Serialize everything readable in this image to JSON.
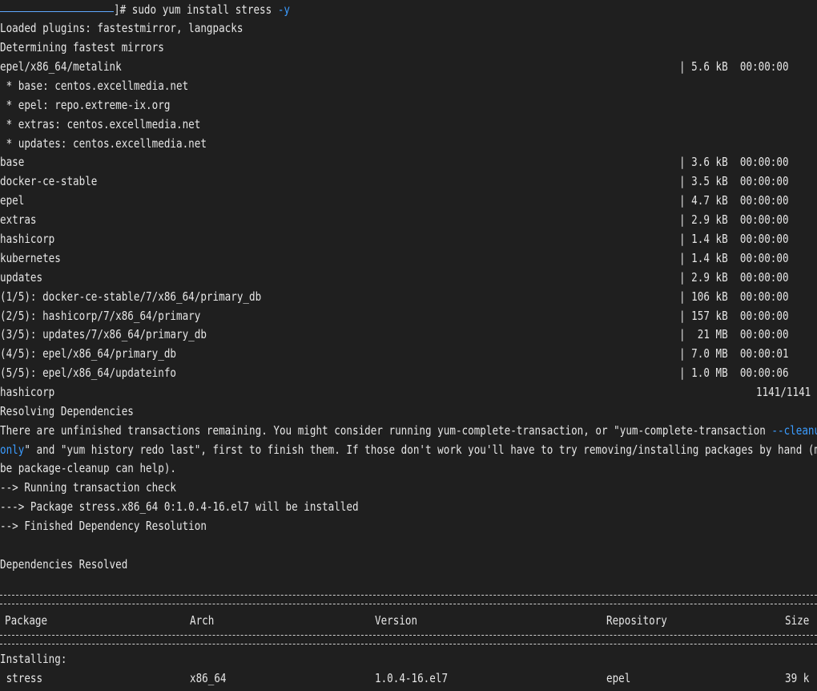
{
  "prompt": {
    "suffix": "]# ",
    "command": "sudo yum install stress ",
    "flag": "-y"
  },
  "lines": {
    "plugins": "Loaded plugins: fastestmirror, langpacks",
    "mirrors": "Determining fastest mirrors",
    "metalink": "epel/x86_64/metalink",
    "base_mirror": " * base: centos.excellmedia.net",
    "epel_mirror": " * epel: repo.extreme-ix.org",
    "extras_mirror": " * extras: centos.excellmedia.net",
    "updates_mirror": " * updates: centos.excellmedia.net",
    "base": "base",
    "docker": "docker-ce-stable",
    "epel": "epel",
    "extras": "extras",
    "hashicorp": "hashicorp",
    "kubernetes": "kubernetes",
    "updates": "updates",
    "dl1": "(1/5): docker-ce-stable/7/x86_64/primary_db",
    "dl2": "(2/5): hashicorp/7/x86_64/primary",
    "dl3": "(3/5): updates/7/x86_64/primary_db",
    "dl4": "(4/5): epel/x86_64/primary_db",
    "dl5": "(5/5): epel/x86_64/updateinfo",
    "hashicorp2": "hashicorp",
    "resolving": "Resolving Dependencies",
    "warn1a": "There are unfinished transactions remaining. You might consider running yum-complete-transaction, or \"yum-complete-transaction ",
    "warn1b": "--cleanup-",
    "warn2a": "only",
    "warn2b": "\" and \"yum history redo last\", first to finish them. If those don't work you'll have to try removing/installing packages by hand (may",
    "warn3": "be package-cleanup can help).",
    "check": "--> Running transaction check",
    "pkg": "---> Package stress.x86_64 0:1.0.4-16.el7 will be installed",
    "finished": "--> Finished Dependency Resolution",
    "resolved": "Dependencies Resolved",
    "installing": "Installing:"
  },
  "sizes": {
    "metalink": "| 5.6 kB  00:00:00",
    "base": "| 3.6 kB  00:00:00",
    "docker": "| 3.5 kB  00:00:00",
    "epel": "| 4.7 kB  00:00:00",
    "extras": "| 2.9 kB  00:00:00",
    "hashicorp": "| 1.4 kB  00:00:00",
    "kubernetes": "| 1.4 kB  00:00:00",
    "updates": "| 2.9 kB  00:00:00",
    "dl1": "| 106 kB  00:00:00",
    "dl2": "| 157 kB  00:00:00",
    "dl3": "|  21 MB  00:00:00",
    "dl4": "| 7.0 MB  00:00:01",
    "dl5": "| 1.0 MB  00:00:06",
    "hashicorp_count": "1141/1141"
  },
  "table": {
    "headers": {
      "package": "Package",
      "arch": "Arch",
      "version": "Version",
      "repository": "Repository",
      "size": "Size"
    },
    "row": {
      "package": " stress",
      "arch": "x86_64",
      "version": "1.0.4-16.el7",
      "repository": "epel",
      "size": "39 k"
    }
  },
  "colors": {
    "background": "#1f1f1f",
    "text": "#e6e6e6",
    "accent": "#3b9cff"
  }
}
